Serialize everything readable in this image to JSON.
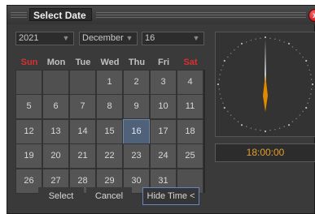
{
  "window": {
    "title": "Select Date",
    "close_glyph": "x"
  },
  "selectors": {
    "year": "2021",
    "month": "December",
    "day": "16"
  },
  "weekdays": [
    {
      "label": "Sun",
      "weekend": true
    },
    {
      "label": "Mon",
      "weekend": false
    },
    {
      "label": "Tue",
      "weekend": false
    },
    {
      "label": "Wed",
      "weekend": false
    },
    {
      "label": "Thu",
      "weekend": false
    },
    {
      "label": "Fri",
      "weekend": false
    },
    {
      "label": "Sat",
      "weekend": true
    }
  ],
  "calendar": {
    "first_weekday_index": 3,
    "days_in_month": 31,
    "selected_day": 16
  },
  "clock": {
    "time": "18:00:00",
    "hour_hand_color": "#e08a00",
    "minute_hand_color": "#f0f0f0"
  },
  "buttons": {
    "select": "Select",
    "cancel": "Cancel",
    "hide_time": "Hide Time <"
  },
  "colors": {
    "accent": "#e39b2e",
    "weekend": "#d83030",
    "selected_cell": "#50627a"
  }
}
